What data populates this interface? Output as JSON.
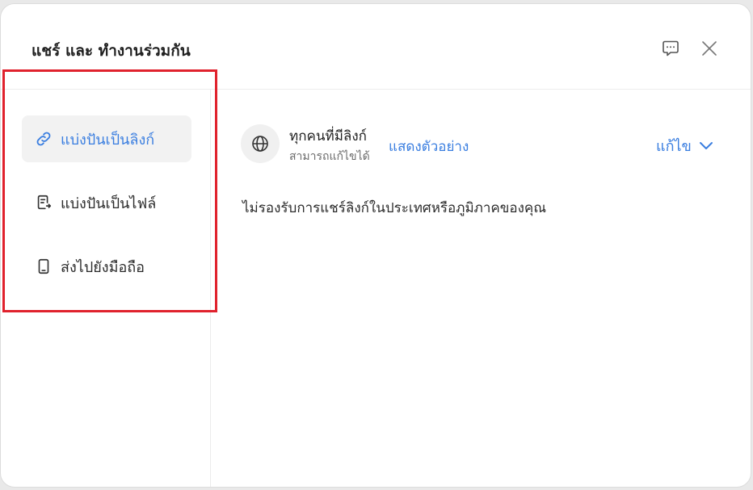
{
  "dialog": {
    "title": "แชร์ และ ทำงานร่วมกัน",
    "feedback_icon": "chat-feedback-icon",
    "close_icon": "close-icon"
  },
  "sidebar": {
    "items": [
      {
        "label": "แบ่งปันเป็นลิงก์",
        "icon": "link-icon",
        "active": true
      },
      {
        "label": "แบ่งปันเป็นไฟล์",
        "icon": "file-share-icon",
        "active": false
      },
      {
        "label": "ส่งไปยังมือถือ",
        "icon": "mobile-phone-icon",
        "active": false
      }
    ]
  },
  "link_settings": {
    "access_title": "ทุกคนที่มีลิงก์",
    "access_subtitle": "สามารถแก้ไขได้",
    "preview_label": "แสดงตัวอย่าง",
    "permission_label": "แก้ไข",
    "notice": "ไม่รองรับการแชร์ลิงก์ในประเทศหรือภูมิภาคของคุณ"
  },
  "colors": {
    "accent": "#3a7ee0",
    "highlight_border": "#e0222d",
    "active_bg": "#f2f2f2"
  }
}
